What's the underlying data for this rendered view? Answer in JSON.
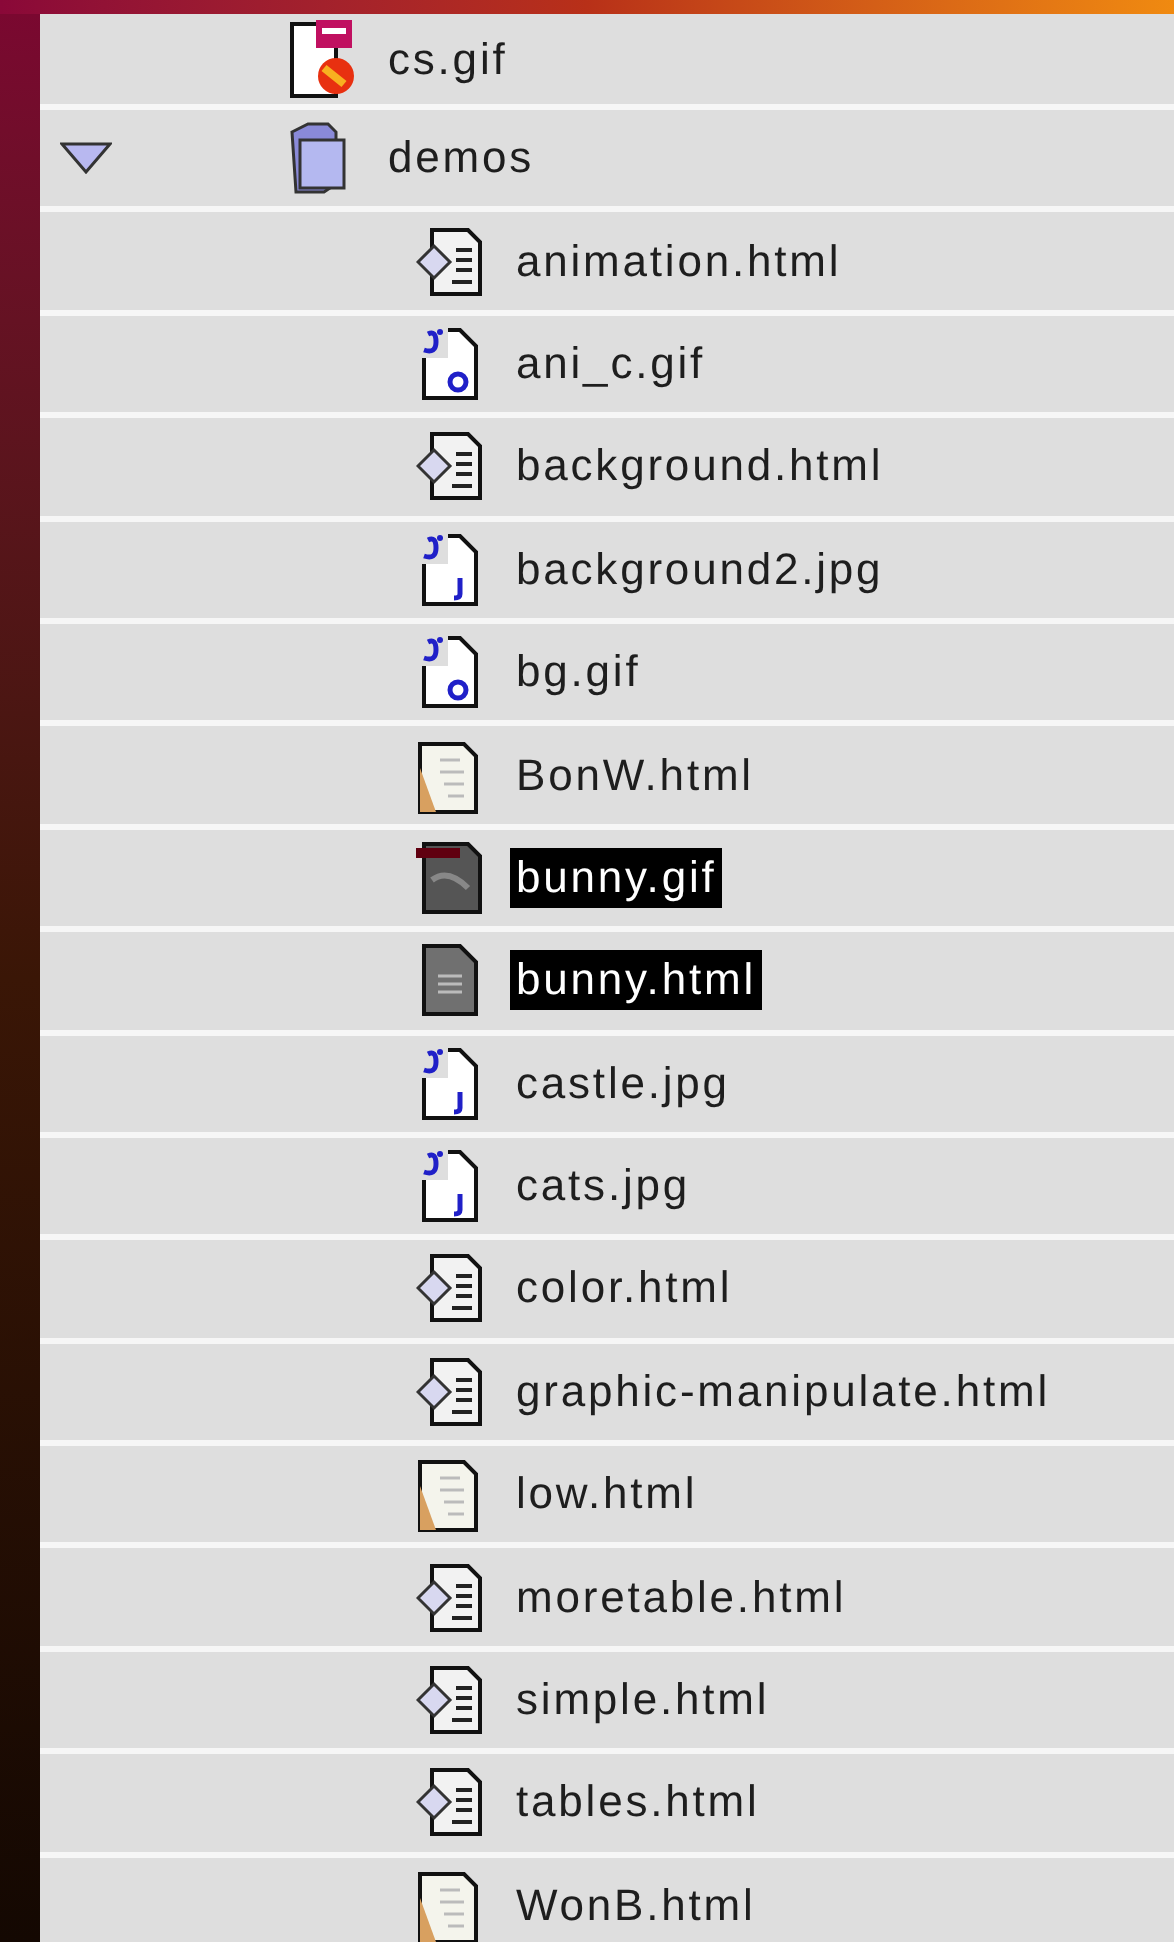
{
  "items": [
    {
      "name": "cs.gif",
      "kind": "gif-doc",
      "selected": false
    },
    {
      "name": "demos",
      "kind": "folder",
      "selected": false,
      "expanded": true,
      "children": [
        {
          "name": "animation.html",
          "kind": "html-doc",
          "selected": false
        },
        {
          "name": "ani_c.gif",
          "kind": "image-g",
          "selected": false
        },
        {
          "name": "background.html",
          "kind": "html-doc",
          "selected": false
        },
        {
          "name": "background2.jpg",
          "kind": "image-j",
          "selected": false
        },
        {
          "name": "bg.gif",
          "kind": "image-g",
          "selected": false
        },
        {
          "name": "BonW.html",
          "kind": "text-doc",
          "selected": false
        },
        {
          "name": "bunny.gif",
          "kind": "dark-image",
          "selected": true
        },
        {
          "name": "bunny.html",
          "kind": "gray-doc",
          "selected": true
        },
        {
          "name": "castle.jpg",
          "kind": "image-j",
          "selected": false
        },
        {
          "name": "cats.jpg",
          "kind": "image-j",
          "selected": false
        },
        {
          "name": "color.html",
          "kind": "html-doc",
          "selected": false
        },
        {
          "name": "graphic-manipulate.html",
          "kind": "html-doc",
          "selected": false
        },
        {
          "name": "low.html",
          "kind": "text-doc",
          "selected": false
        },
        {
          "name": "moretable.html",
          "kind": "html-doc",
          "selected": false
        },
        {
          "name": "simple.html",
          "kind": "html-doc",
          "selected": false
        },
        {
          "name": "tables.html",
          "kind": "html-doc",
          "selected": false
        },
        {
          "name": "WonB.html",
          "kind": "text-doc",
          "selected": false
        }
      ]
    }
  ]
}
